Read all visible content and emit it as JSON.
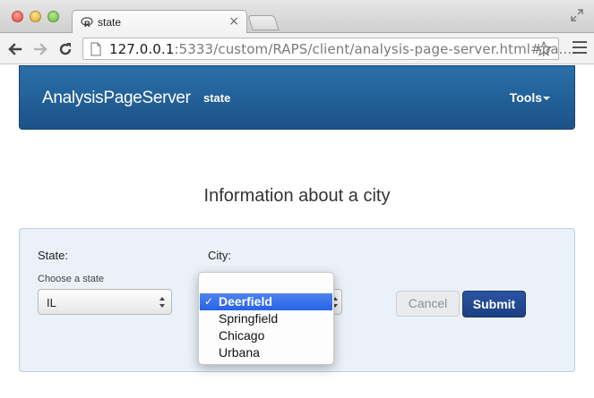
{
  "browser": {
    "tab_title": "state",
    "tab_close": "×",
    "url_host": "127.0.0.1",
    "url_rest": ":5333/custom/RAPS/client/analysis-page-server.html#pa..."
  },
  "navbar": {
    "brand": "AnalysisPageServer",
    "page": "state",
    "tools": "Tools"
  },
  "main": {
    "title": "Information about a city"
  },
  "form": {
    "state_label": "State:",
    "state_hint": "Choose a state",
    "state_value": "IL",
    "city_label": "City:",
    "city_options": [
      "Deerfield",
      "Springfield",
      "Chicago",
      "Urbana"
    ],
    "city_selected": "Deerfield",
    "check": "✓",
    "cancel_label": "Cancel",
    "submit_label": "Submit"
  },
  "colors": {
    "navbar": "#1f5a93",
    "submit": "#234a94",
    "selection": "#3a73ea",
    "panel": "#eaf1f8"
  }
}
